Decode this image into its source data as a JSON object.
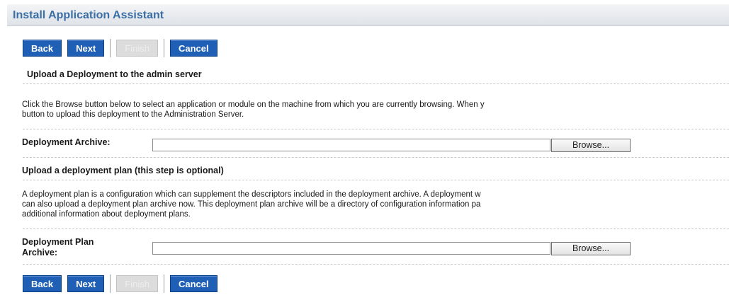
{
  "header": {
    "title": "Install Application Assistant"
  },
  "buttons": {
    "back": "Back",
    "next": "Next",
    "finish": "Finish",
    "cancel": "Cancel"
  },
  "upload_section": {
    "heading": "Upload a Deployment to the admin server",
    "description_line1": "Click the Browse button below to select an application or module on the machine from which you are currently browsing. When y",
    "description_line2": "button to upload this deployment to the Administration Server.",
    "archive_label": "Deployment Archive:",
    "archive_value": "",
    "browse_label": "Browse..."
  },
  "plan_section": {
    "heading": "Upload a deployment plan (this step is optional)",
    "description_line1": "A deployment plan is a configuration which can supplement the descriptors included in the deployment archive. A deployment w",
    "description_line2": "can also upload a deployment plan archive now. This deployment plan archive will be a directory of configuration information pa",
    "description_line3": "additional information about deployment plans.",
    "archive_label_line1": "Deployment Plan",
    "archive_label_line2": "Archive:",
    "archive_value": "",
    "browse_label": "Browse..."
  }
}
